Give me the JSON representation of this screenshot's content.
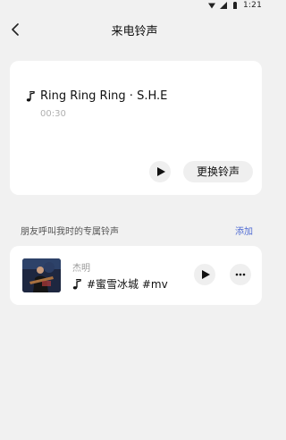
{
  "status_bar": {
    "time": "1:21",
    "icons": [
      "wifi-icon",
      "signal-icon",
      "battery-icon"
    ]
  },
  "header": {
    "title": "来电铃声",
    "back_icon": "back-arrow-icon"
  },
  "current_ringtone": {
    "icon": "music-note-icon",
    "title": "Ring Ring Ring · S.H.E",
    "duration": "00:30",
    "play_icon": "play-icon",
    "change_label": "更换铃声"
  },
  "friends_section": {
    "label": "朋友呼叫我时的专属铃声",
    "add_label": "添加",
    "accent_color": "#4f6bd3",
    "items": [
      {
        "name": "杰明",
        "song": "#蜜雪冰城 #mv",
        "song_icon": "music-note-icon",
        "play_icon": "play-icon",
        "more_icon": "more-dots-icon"
      }
    ]
  }
}
